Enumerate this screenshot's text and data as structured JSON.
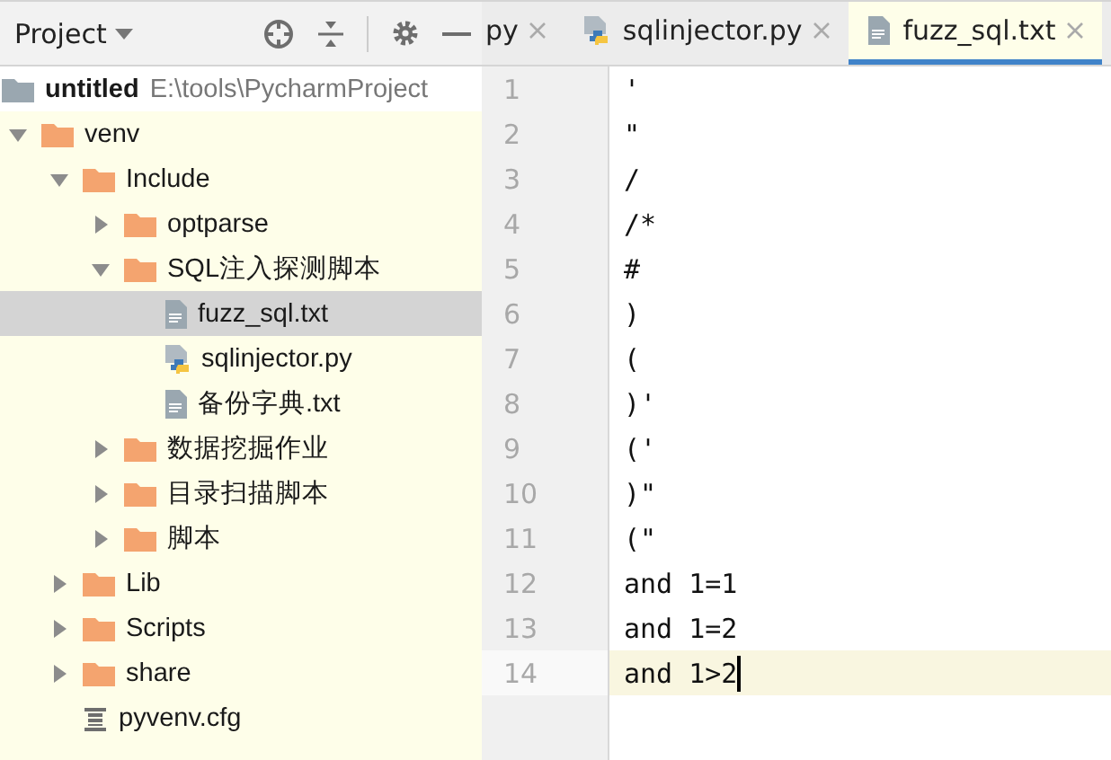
{
  "project_panel": {
    "title": "Project",
    "tree": [
      {
        "kind": "root",
        "label": "untitled",
        "path": "E:\\tools\\PycharmProject",
        "children": [
          {
            "kind": "folder",
            "label": "venv",
            "expanded": true,
            "selected": false,
            "children": [
              {
                "kind": "folder",
                "label": "Include",
                "expanded": true,
                "selected": false,
                "children": [
                  {
                    "kind": "folder",
                    "label": "optparse",
                    "expanded": false,
                    "selected": false
                  },
                  {
                    "kind": "folder",
                    "label": "SQL注入探测脚本",
                    "expanded": true,
                    "selected": false,
                    "children": [
                      {
                        "kind": "text",
                        "label": "fuzz_sql.txt",
                        "selected": true
                      },
                      {
                        "kind": "python",
                        "label": "sqlinjector.py",
                        "selected": false
                      },
                      {
                        "kind": "text",
                        "label": "备份字典.txt",
                        "selected": false
                      }
                    ]
                  },
                  {
                    "kind": "folder",
                    "label": "数据挖掘作业",
                    "expanded": false,
                    "selected": false
                  },
                  {
                    "kind": "folder",
                    "label": "目录扫描脚本",
                    "expanded": false,
                    "selected": false
                  },
                  {
                    "kind": "folder",
                    "label": "脚本",
                    "expanded": false,
                    "selected": false
                  }
                ]
              },
              {
                "kind": "folder",
                "label": "Lib",
                "expanded": false,
                "selected": false
              },
              {
                "kind": "folder",
                "label": "Scripts",
                "expanded": false,
                "selected": false
              },
              {
                "kind": "folder",
                "label": "share",
                "expanded": false,
                "selected": false
              },
              {
                "kind": "config",
                "label": "pyvenv.cfg",
                "selected": false
              }
            ]
          }
        ]
      }
    ]
  },
  "editor": {
    "tabs": [
      {
        "label": "py",
        "selected": false
      },
      {
        "kind": "python",
        "label": "sqlinjector.py",
        "selected": false
      },
      {
        "kind": "text",
        "label": "fuzz_sql.txt",
        "selected": true
      }
    ],
    "lines": [
      {
        "number": "1",
        "text": "'",
        "current": false
      },
      {
        "number": "2",
        "text": "\"",
        "current": false
      },
      {
        "number": "3",
        "text": "/",
        "current": false
      },
      {
        "number": "4",
        "text": "/*",
        "current": false
      },
      {
        "number": "5",
        "text": "#",
        "current": false
      },
      {
        "number": "6",
        "text": ")",
        "current": false
      },
      {
        "number": "7",
        "text": "(",
        "current": false
      },
      {
        "number": "8",
        "text": ")'",
        "current": false
      },
      {
        "number": "9",
        "text": "('",
        "current": false
      },
      {
        "number": "10",
        "text": ")\"",
        "current": false
      },
      {
        "number": "11",
        "text": "(\"",
        "current": false
      },
      {
        "number": "12",
        "text": "and 1=1",
        "current": false
      },
      {
        "number": "13",
        "text": "and 1=2",
        "current": false
      },
      {
        "number": "14",
        "text": "and 1>2",
        "current": true
      }
    ]
  }
}
